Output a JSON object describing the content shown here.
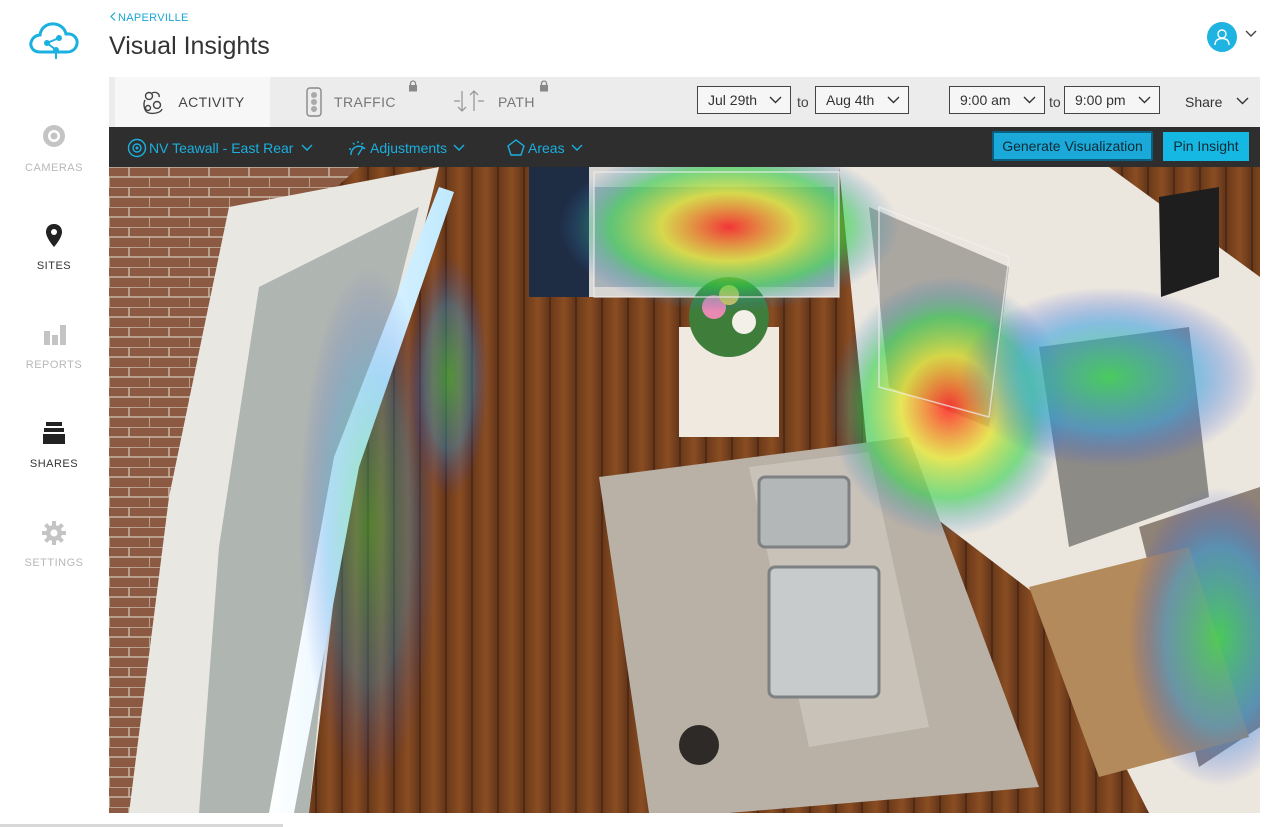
{
  "breadcrumb": "NAPERVILLE",
  "page_title": "Visual Insights",
  "sidebar": {
    "items": [
      {
        "label": "CAMERAS",
        "icon": "camera-icon",
        "active": false
      },
      {
        "label": "SITES",
        "icon": "map-pin-icon",
        "active": true
      },
      {
        "label": "REPORTS",
        "icon": "bar-chart-icon",
        "active": false
      },
      {
        "label": "SHARES",
        "icon": "stack-icon",
        "active": true
      },
      {
        "label": "SETTINGS",
        "icon": "gear-icon",
        "active": false
      }
    ]
  },
  "tabs": [
    {
      "label": "ACTIVITY",
      "icon": "activity-icon",
      "locked": false,
      "active": true
    },
    {
      "label": "TRAFFIC",
      "icon": "traffic-light-icon",
      "locked": true,
      "active": false
    },
    {
      "label": "PATH",
      "icon": "path-arrows-icon",
      "locked": true,
      "active": false
    }
  ],
  "date_range": {
    "from": "Jul 29th",
    "to": "Aug 4th",
    "separator": "to"
  },
  "time_range": {
    "from": "9:00 am",
    "to": "9:00 pm",
    "separator": "to"
  },
  "share_label": "Share",
  "controls": {
    "camera": "NV Teawall - East Rear",
    "adjustments": "Adjustments",
    "areas": "Areas",
    "generate_button": "Generate Visualization",
    "pin_button": "Pin Insight"
  },
  "colors": {
    "accent": "#1ab0e0",
    "dark_bar": "#2e2e2e",
    "toolbar": "#ececec",
    "avatar": "#1fb3e2"
  }
}
